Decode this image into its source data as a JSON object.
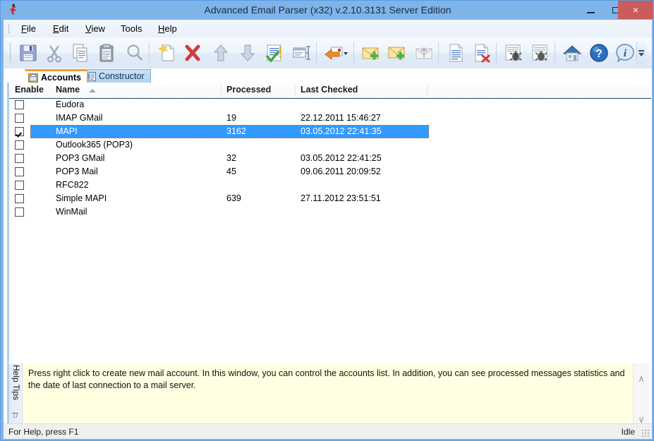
{
  "window": {
    "title": "Advanced Email Parser (x32) v.2.10.3131 Server Edition",
    "app_icon": "red-figure-icon",
    "minimize_label": "",
    "maximize_label": "",
    "close_label": "×",
    "titlebar_color": "#7eb4ea",
    "close_button_color": "#cc5b5b"
  },
  "menubar": {
    "items": [
      {
        "label": "File",
        "accel": "F"
      },
      {
        "label": "Edit",
        "accel": "E"
      },
      {
        "label": "View",
        "accel": "V"
      },
      {
        "label": "Tools",
        "accel": ""
      },
      {
        "label": "Help",
        "accel": "H"
      }
    ]
  },
  "toolbar": {
    "buttons": [
      {
        "name": "save-button",
        "icon": "floppy-disk-icon",
        "label": "Save"
      },
      {
        "name": "cut-button",
        "icon": "scissors-icon",
        "label": "Cut"
      },
      {
        "name": "copy-button",
        "icon": "copy-pages-icon",
        "label": "Copy"
      },
      {
        "name": "paste-button",
        "icon": "clipboard-icon",
        "label": "Paste"
      },
      {
        "name": "find-button",
        "icon": "magnifier-icon",
        "label": "Find"
      },
      {
        "name": "new-button",
        "icon": "new-document-icon",
        "label": "New"
      },
      {
        "name": "delete-button",
        "icon": "red-x-icon",
        "label": "Delete"
      },
      {
        "name": "move-up-button",
        "icon": "arrow-up-icon",
        "label": "Move Up"
      },
      {
        "name": "move-down-button",
        "icon": "arrow-down-icon",
        "label": "Move Down"
      },
      {
        "name": "check-button",
        "icon": "checklist-icon",
        "label": "Check"
      },
      {
        "name": "properties-button",
        "icon": "window-properties-icon",
        "label": "Properties"
      },
      {
        "name": "reply-button",
        "icon": "orange-back-arrow-icon",
        "label": "Reply"
      },
      {
        "name": "new-mail-button",
        "icon": "envelope-plus-icon",
        "label": "New Mail"
      },
      {
        "name": "new-mail-alt-button",
        "icon": "envelope-plus-icon",
        "label": "New Mail Account"
      },
      {
        "name": "send-mail-button",
        "icon": "envelope-up-arrow-icon",
        "label": "Send Mail"
      },
      {
        "name": "report-button",
        "icon": "document-lines-icon",
        "label": "Report"
      },
      {
        "name": "delete-report-button",
        "icon": "document-delete-icon",
        "label": "Delete Report"
      },
      {
        "name": "debug-button",
        "icon": "bug-page-icon",
        "label": "Debug"
      },
      {
        "name": "debug-alt-button",
        "icon": "bug-page-icon",
        "label": "Debug Log"
      },
      {
        "name": "home-button",
        "icon": "house-icon",
        "label": "Home"
      },
      {
        "name": "help-button",
        "icon": "blue-question-icon",
        "label": "Help"
      },
      {
        "name": "about-button",
        "icon": "blue-info-icon",
        "label": "About"
      }
    ],
    "overflow_label": "More toolbar buttons"
  },
  "tabs": [
    {
      "label": "Accounts",
      "icon": "accounts-icon",
      "active": true
    },
    {
      "label": "Constructor",
      "icon": "constructor-icon",
      "active": false
    }
  ],
  "listview": {
    "columns": [
      {
        "key": "enable",
        "label": "Enable"
      },
      {
        "key": "name",
        "label": "Name",
        "sorted": "asc"
      },
      {
        "key": "processed",
        "label": "Processed"
      },
      {
        "key": "last_checked",
        "label": "Last Checked"
      }
    ],
    "rows": [
      {
        "enabled": false,
        "name": "Eudora",
        "processed": "",
        "last_checked": "",
        "selected": false
      },
      {
        "enabled": false,
        "name": "IMAP GMail",
        "processed": "19",
        "last_checked": "22.12.2011 15:46:27",
        "selected": false
      },
      {
        "enabled": true,
        "name": "MAPI",
        "processed": "3162",
        "last_checked": "03.05.2012 22:41:35",
        "selected": true
      },
      {
        "enabled": false,
        "name": "Outlook365 (POP3)",
        "processed": "",
        "last_checked": "",
        "selected": false
      },
      {
        "enabled": false,
        "name": "POP3 GMail",
        "processed": "32",
        "last_checked": "03.05.2012 22:41:25",
        "selected": false
      },
      {
        "enabled": false,
        "name": "POP3 Mail",
        "processed": "45",
        "last_checked": "09.06.2011 20:09:52",
        "selected": false
      },
      {
        "enabled": false,
        "name": "RFC822",
        "processed": "",
        "last_checked": "",
        "selected": false
      },
      {
        "enabled": false,
        "name": "Simple MAPI",
        "processed": "639",
        "last_checked": "27.11.2012 23:51:51",
        "selected": false
      },
      {
        "enabled": false,
        "name": "WinMail",
        "processed": "",
        "last_checked": "",
        "selected": false
      }
    ],
    "selection_color": "#3399ff"
  },
  "help_panel": {
    "title": "Help Tips",
    "pin_label": "⚐",
    "close_label": "×",
    "text": "Press right click to create new mail account. In this window, you can control the accounts list. In addition, you can see processed messages statistics and the date of last connection to a mail server.",
    "background_color": "#ffffe1",
    "scroll_up": "∧",
    "scroll_down": "∨"
  },
  "statusbar": {
    "left": "For Help, press F1",
    "right": "Idle"
  }
}
